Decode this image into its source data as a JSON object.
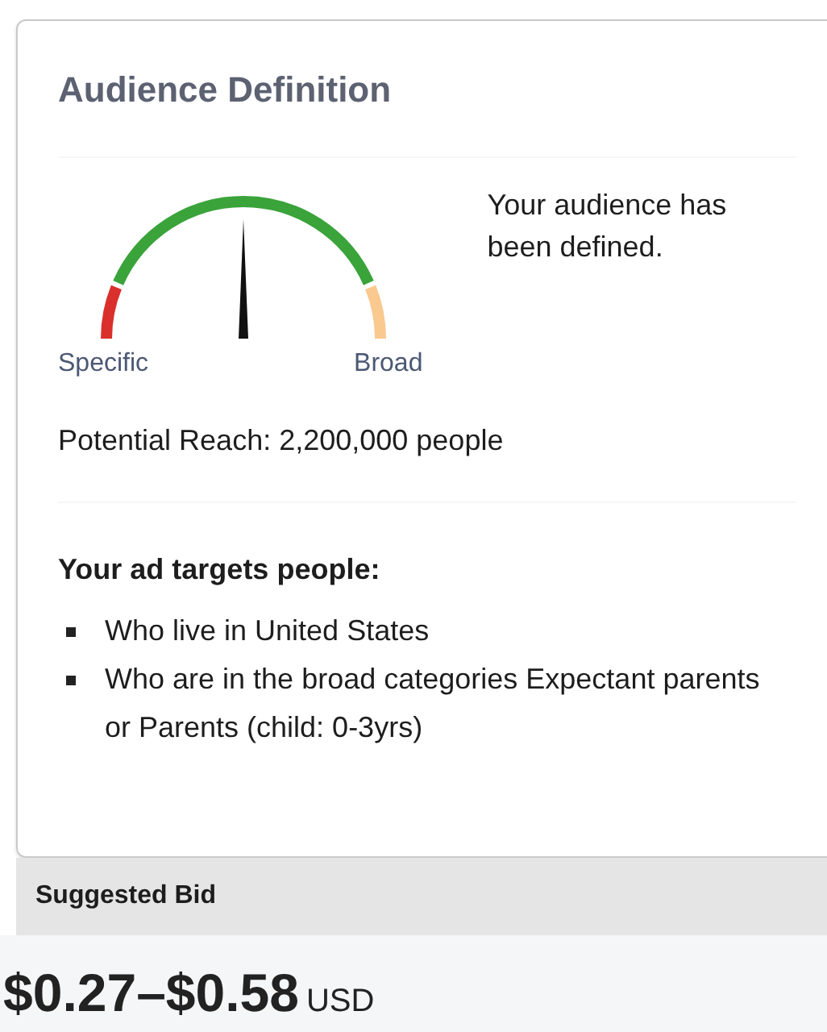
{
  "audience": {
    "title": "Audience Definition",
    "gauge": {
      "min_label": "Specific",
      "max_label": "Broad"
    },
    "status": "Your audience has been defined.",
    "potential_reach": "Potential Reach: 2,200,000 people",
    "targets_heading": "Your ad targets people:",
    "targets": [
      "Who live in United States",
      "Who are in the broad categories Expectant parents or Parents (child: 0-3yrs)"
    ]
  },
  "suggested_bid": {
    "heading": "Suggested Bid",
    "range": "$0.27–$0.58",
    "currency": "USD"
  }
}
